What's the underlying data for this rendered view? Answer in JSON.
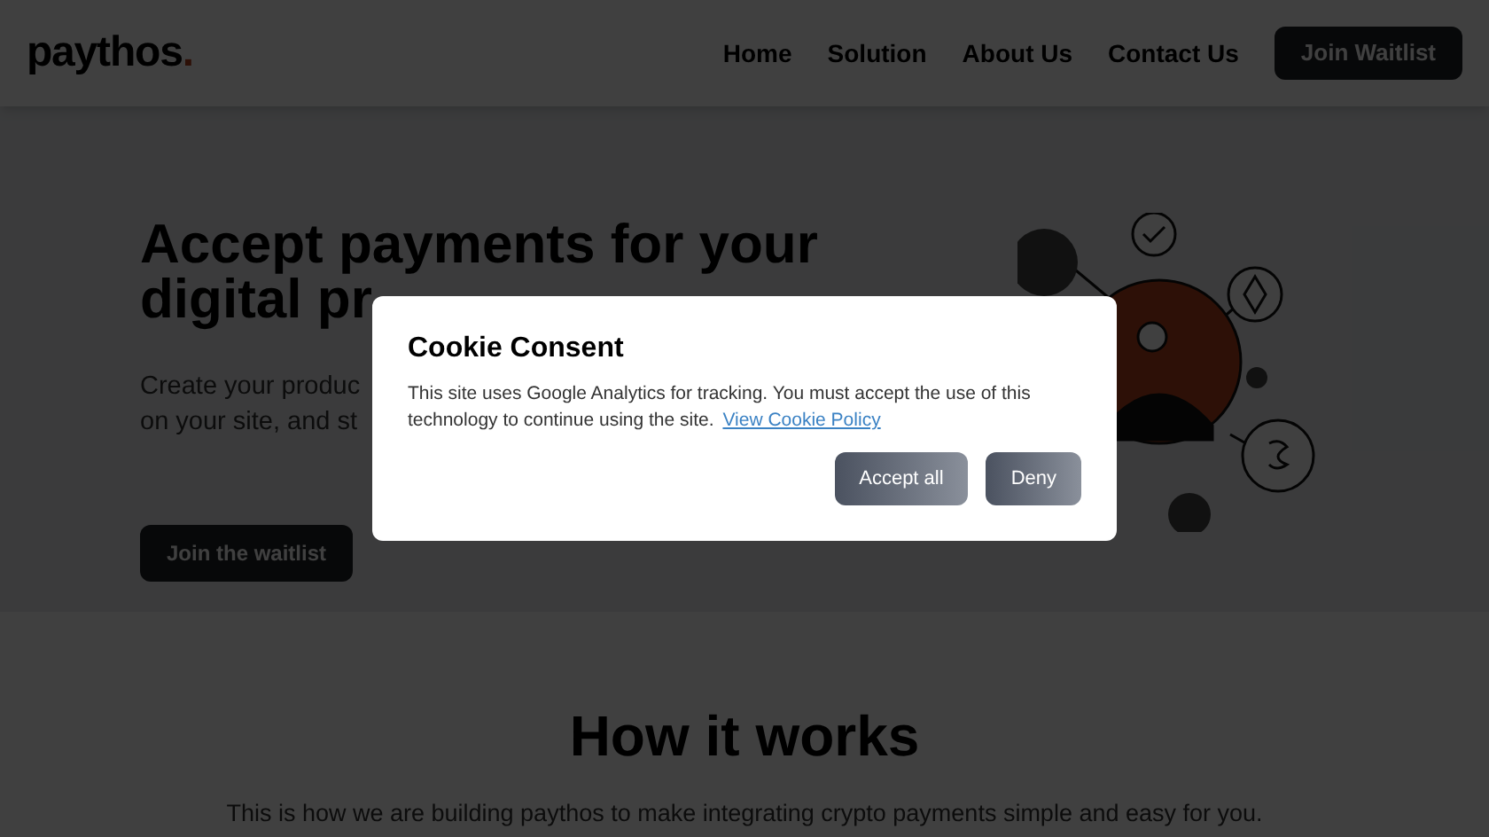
{
  "header": {
    "logo": "paythos",
    "logo_dot": ".",
    "nav": [
      {
        "label": "Home"
      },
      {
        "label": "Solution"
      },
      {
        "label": "About Us"
      },
      {
        "label": "Contact Us"
      }
    ],
    "cta": "Join Waitlist"
  },
  "hero": {
    "title_lines": [
      "Accept payments for your",
      "digital pr"
    ],
    "subtitle_lines": [
      "Create your produc",
      "on your site, and st"
    ],
    "button": "Join the waitlist"
  },
  "section": {
    "title": "How it works",
    "text": "This is how we are building paythos to make integrating crypto payments simple and easy for you."
  },
  "cookie_dialog": {
    "title": "Cookie Consent",
    "text": "This site uses Google Analytics for tracking. You must accept the use of this technology to continue using the site.",
    "link": "View Cookie Policy",
    "buttons": [
      "Accept all",
      "Deny"
    ]
  }
}
